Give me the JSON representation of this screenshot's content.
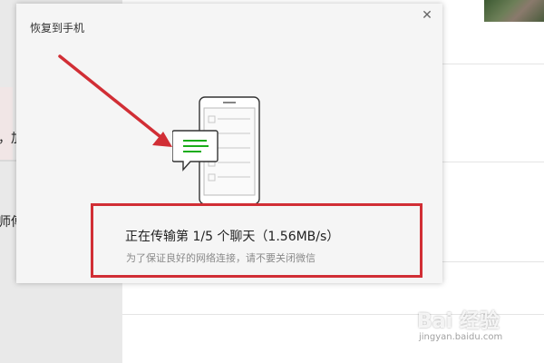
{
  "dialog": {
    "title": "恢复到手机",
    "close_icon": "close-icon",
    "status_title": "正在传输第 1/5 个聊天（1.56MB/s）",
    "status_subtitle": "为了保证良好的网络连接，请不要关闭微信"
  },
  "background": {
    "fragment_1": "，加",
    "fragment_2": "师傅"
  },
  "watermark": {
    "brand": "Bai 经验",
    "url": "jingyan.baidu.com"
  },
  "colors": {
    "accent_red": "#d12e35",
    "message_green": "#1aad19"
  }
}
